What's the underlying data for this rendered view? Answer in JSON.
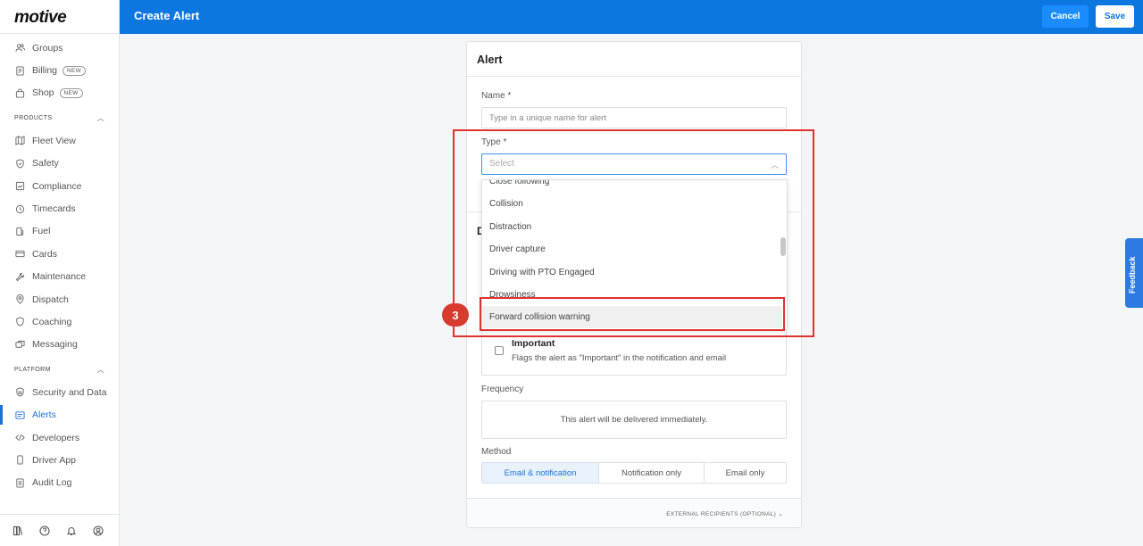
{
  "app": {
    "logo": "motive",
    "page_title": "Create Alert"
  },
  "topbar": {
    "cancel_label": "Cancel",
    "save_label": "Save"
  },
  "sidebar": {
    "top_items": [
      {
        "label": "Groups",
        "icon": "users-icon"
      },
      {
        "label": "Billing",
        "icon": "document-icon",
        "badge": "NEW"
      },
      {
        "label": "Shop",
        "icon": "bag-icon",
        "badge": "NEW"
      }
    ],
    "products_header": "PRODUCTS",
    "products": [
      {
        "label": "Fleet View",
        "icon": "map-icon"
      },
      {
        "label": "Safety",
        "icon": "shield-icon"
      },
      {
        "label": "Compliance",
        "icon": "compliance-icon"
      },
      {
        "label": "Timecards",
        "icon": "clock-icon"
      },
      {
        "label": "Fuel",
        "icon": "fuel-icon"
      },
      {
        "label": "Cards",
        "icon": "card-icon"
      },
      {
        "label": "Maintenance",
        "icon": "wrench-icon"
      },
      {
        "label": "Dispatch",
        "icon": "pin-icon"
      },
      {
        "label": "Coaching",
        "icon": "coaching-icon"
      },
      {
        "label": "Messaging",
        "icon": "chat-icon"
      }
    ],
    "platform_header": "PLATFORM",
    "platform": [
      {
        "label": "Security and Data",
        "icon": "lock-shield-icon"
      },
      {
        "label": "Alerts",
        "icon": "alert-icon",
        "active": true
      },
      {
        "label": "Developers",
        "icon": "code-icon"
      },
      {
        "label": "Driver App",
        "icon": "phone-icon"
      },
      {
        "label": "Audit Log",
        "icon": "log-icon"
      }
    ],
    "footer_icons": [
      "library-icon",
      "help-icon",
      "bell-icon",
      "profile-icon"
    ]
  },
  "form": {
    "section_title": "Alert",
    "name_label": "Name *",
    "name_placeholder": "Type in a unique name for alert",
    "type_label": "Type *",
    "type_placeholder": "Select",
    "type_options": [
      "Close following",
      "Collision",
      "Distraction",
      "Driver capture",
      "Driving with PTO Engaged",
      "Drowsiness",
      "Forward collision warning"
    ],
    "highlighted_option": "Forward collision warning",
    "second_section_initial": "D",
    "important_title": "Important",
    "important_desc": "Flags the alert as \"Important\" in the notification and email",
    "frequency_label": "Frequency",
    "frequency_text": "This alert will be delivered immediately.",
    "method_label": "Method",
    "method_options": [
      "Email & notification",
      "Notification only",
      "Email only"
    ],
    "method_selected": "Email & notification",
    "footer_link": "EXTERNAL RECIPIENTS (OPTIONAL) ⌄"
  },
  "annotation": {
    "step_number": "3"
  },
  "feedback_label": "Feedback",
  "colors": {
    "brand_blue": "#0d77e0",
    "annotation_red": "#e0322f",
    "active_blue": "#1e6fd9"
  }
}
